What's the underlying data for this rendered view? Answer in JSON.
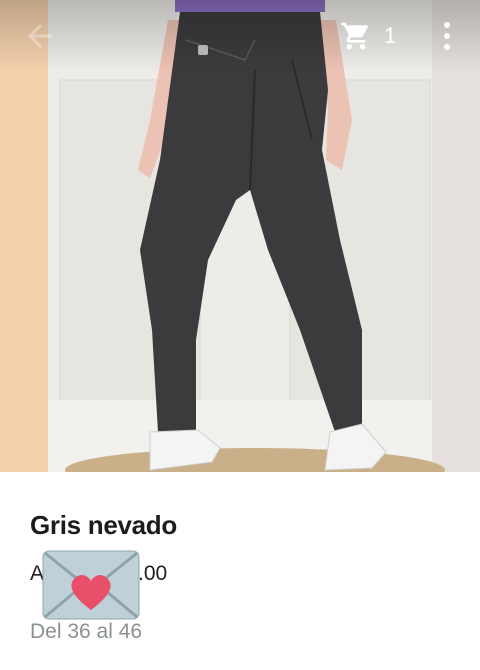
{
  "header": {
    "cart_count": "1",
    "icons": {
      "back": "arrow-back-icon",
      "cart": "cart-icon",
      "menu": "more-vert-icon"
    }
  },
  "hero": {
    "image": "gray skinny jeans product photo"
  },
  "product": {
    "title": "Gris nevado",
    "price_prefix": "A",
    "price_suffix": ".00",
    "sizes": "Del 36 al 46"
  },
  "overlay": {
    "sticker": "envelope-heart-icon"
  },
  "colors": {
    "title": "#1c1c1c",
    "sizes": "#8a9190",
    "heart": "#e8506a",
    "envelope": "#bfd0d8"
  }
}
